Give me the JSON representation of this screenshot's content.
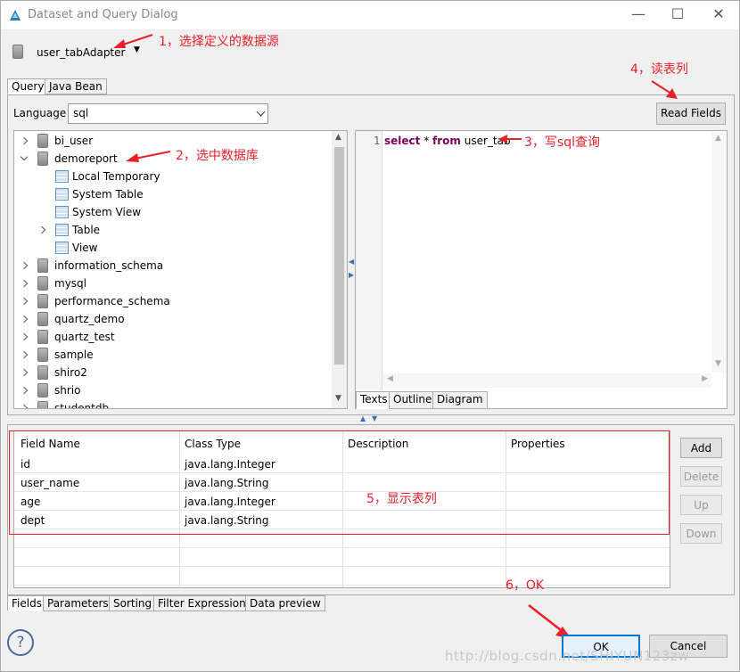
{
  "window": {
    "title": "Dataset and Query Dialog",
    "minimize": "—",
    "maximize": "☐",
    "close": "✕"
  },
  "datasource": {
    "name": "user_tabAdapter",
    "annotation": "1，选择定义的数据源"
  },
  "top_tabs": [
    "Query",
    "Java Bean"
  ],
  "language": {
    "label": "Language",
    "value": "sql"
  },
  "read_fields": {
    "label": "Read Fields",
    "annotation": "4，读表列"
  },
  "tree": {
    "annotation": "2，选中数据库",
    "items": [
      {
        "label": "bi_user",
        "type": "db",
        "arrow": "right",
        "indent": 0
      },
      {
        "label": "demoreport",
        "type": "db",
        "arrow": "down",
        "indent": 0
      },
      {
        "label": "Local Temporary",
        "type": "table",
        "arrow": "",
        "indent": 1
      },
      {
        "label": "System Table",
        "type": "table",
        "arrow": "",
        "indent": 1
      },
      {
        "label": "System View",
        "type": "table",
        "arrow": "",
        "indent": 1
      },
      {
        "label": "Table",
        "type": "table",
        "arrow": "right",
        "indent": 1
      },
      {
        "label": "View",
        "type": "table",
        "arrow": "",
        "indent": 1
      },
      {
        "label": "information_schema",
        "type": "db",
        "arrow": "right",
        "indent": 0
      },
      {
        "label": "mysql",
        "type": "db",
        "arrow": "right",
        "indent": 0
      },
      {
        "label": "performance_schema",
        "type": "db",
        "arrow": "right",
        "indent": 0
      },
      {
        "label": "quartz_demo",
        "type": "db",
        "arrow": "right",
        "indent": 0
      },
      {
        "label": "quartz_test",
        "type": "db",
        "arrow": "right",
        "indent": 0
      },
      {
        "label": "sample",
        "type": "db",
        "arrow": "right",
        "indent": 0
      },
      {
        "label": "shiro2",
        "type": "db",
        "arrow": "right",
        "indent": 0
      },
      {
        "label": "shrio",
        "type": "db",
        "arrow": "right",
        "indent": 0
      },
      {
        "label": "studentdb",
        "type": "db",
        "arrow": "right",
        "indent": 0
      }
    ]
  },
  "editor": {
    "line_number": "1",
    "kw_select": "select",
    "star": " * ",
    "kw_from": "from",
    "table": " user_tab",
    "annotation": "3，写sql查询",
    "tabs": [
      "Texts",
      "Outline",
      "Diagram"
    ]
  },
  "fields_table": {
    "columns": [
      "Field Name",
      "Class Type",
      "Description",
      "Properties"
    ],
    "rows": [
      [
        "id",
        "java.lang.Integer",
        "",
        ""
      ],
      [
        "user_name",
        "java.lang.String",
        "",
        ""
      ],
      [
        "age",
        "java.lang.Integer",
        "",
        ""
      ],
      [
        "dept",
        "java.lang.String",
        "",
        ""
      ]
    ],
    "annotation": "5，显示表列"
  },
  "side_buttons": {
    "add": "Add",
    "delete": "Delete",
    "up": "Up",
    "down": "Down"
  },
  "bottom_tabs": [
    "Fields",
    "Parameters",
    "Sorting",
    "Filter Expression",
    "Data preview"
  ],
  "footer": {
    "help": "?",
    "ok": "OK",
    "cancel": "Cancel",
    "ok_annotation": "6，OK",
    "watermark": "http://blog.csdn.net/SHIYUN123zw"
  },
  "colors": {
    "annotation": "#e8202a",
    "keyword": "#7f0055",
    "ok_border": "#0078d7",
    "selection": "#cce8ff"
  }
}
